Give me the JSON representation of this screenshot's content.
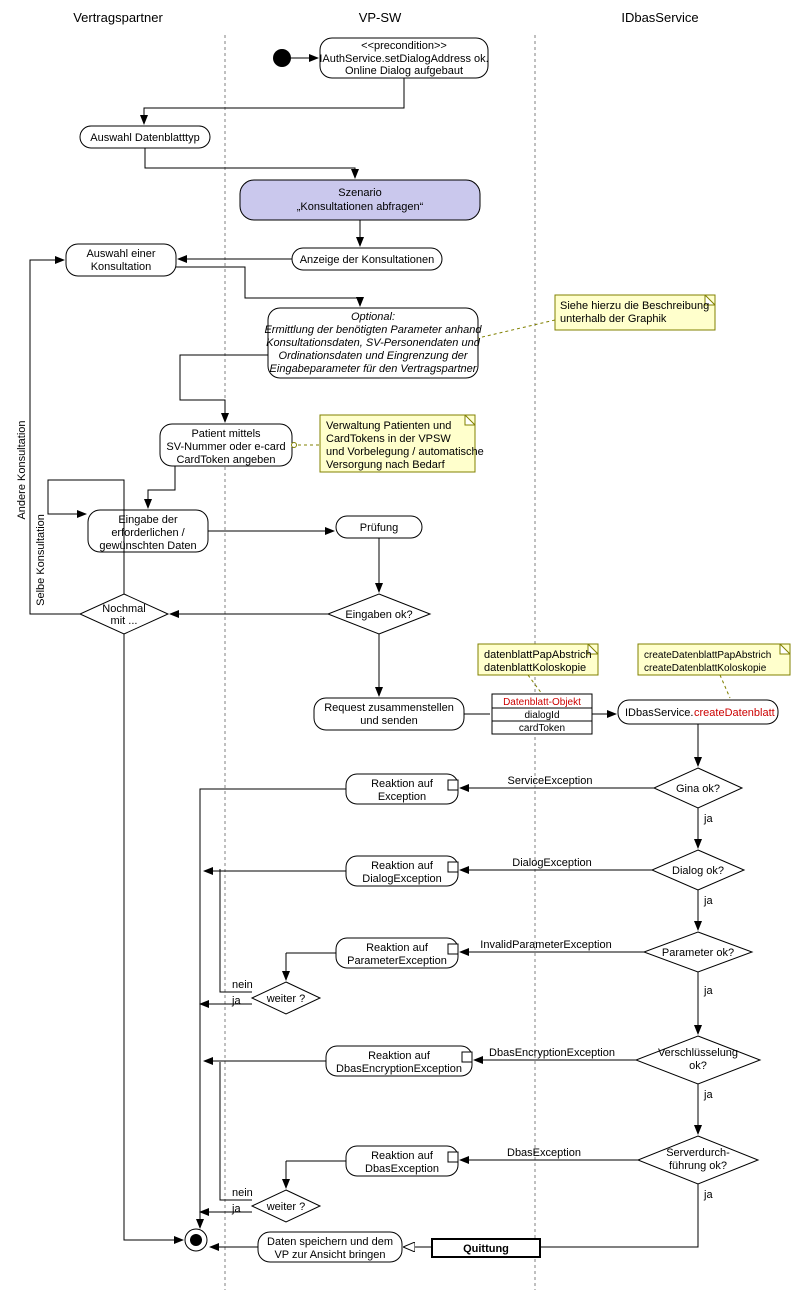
{
  "lanes": {
    "l1": "Vertragspartner",
    "l2": "VP-SW",
    "l3": "IDbasService"
  },
  "precond": {
    "t1": "<<precondition>>",
    "t2": "IAuthService.setDialogAddress ok.",
    "t3": "Online Dialog aufgebaut"
  },
  "a1": "Auswahl Datenblatttyp",
  "scen": {
    "t1": "Szenario",
    "t2": "„Konsultationen abfragen“"
  },
  "a2": "Anzeige der Konsultationen",
  "a3": {
    "t1": "Auswahl einer",
    "t2": "Konsultation"
  },
  "opt": {
    "t1": "Optional:",
    "t2": "Ermittlung der benötigten Parameter anhand",
    "t3": "Konsultationsdaten, SV-Personendaten und",
    "t4": "Ordinationsdaten und Eingrenzung der",
    "t5": "Eingabeparameter für den Vertragspartner"
  },
  "note1": {
    "t1": "Siehe hierzu die Beschreibung",
    "t2": "unterhalb der Graphik"
  },
  "a4": {
    "t1": "Patient mittels",
    "t2": "SV-Nummer oder e-card",
    "t3": "CardToken angeben"
  },
  "note2": {
    "t1": "Verwaltung Patienten und",
    "t2": "CardTokens in der VPSW",
    "t3": "und Vorbelegung / automatische",
    "t4": "Versorgung nach Bedarf"
  },
  "a5": {
    "t1": "Eingabe der",
    "t2": "erforderlichen /",
    "t3": "gewünschten Daten"
  },
  "a6": "Prüfung",
  "d1": "Eingaben ok?",
  "d2": {
    "t1": "Nochmal",
    "t2": "mit ..."
  },
  "edgeL1": "Andere Konsultation",
  "edgeL2": "Selbe Konsultation",
  "a7": {
    "t1": "Request zusammenstellen",
    "t2": "und senden"
  },
  "obj": {
    "t1": "Datenblatt-Objekt",
    "t2": "dialogId",
    "t3": "cardToken"
  },
  "note3": {
    "t1": "datenblattPapAbstrich",
    "t2": "datenblattKoloskopie"
  },
  "a8": {
    "t1": "IDbasService.",
    "t2": "createDatenblatt"
  },
  "note4": {
    "t1": "createDatenblattPapAbstrich",
    "t2": "createDatenblattKoloskopie"
  },
  "dec": {
    "gina": "Gina ok?",
    "dialog": "Dialog ok?",
    "param": "Parameter ok?",
    "enc1": "Verschlüsselung",
    "enc2": "ok?",
    "srv1": "Serverdurch-",
    "srv2": "führung ok?"
  },
  "reac": {
    "e": "Reaktion auf",
    "e2": "Exception",
    "d": "Reaktion auf",
    "d2": "DialogException",
    "p": "Reaktion auf",
    "p2": "ParameterException",
    "en": "Reaktion auf",
    "en2": "DbasEncryptionException",
    "db": "Reaktion auf",
    "db2": "DbasException"
  },
  "exlbl": {
    "se": "ServiceException",
    "de": "DialogException",
    "ipe": "InvalidParameterException",
    "dee": "DbasEncryptionException",
    "dbe": "DbasException"
  },
  "ja": "ja",
  "nein": "nein",
  "weiter": "weiter ?",
  "quit": "Quittung",
  "a9": {
    "t1": "Daten speichern und dem",
    "t2": "VP zur Ansicht bringen"
  }
}
